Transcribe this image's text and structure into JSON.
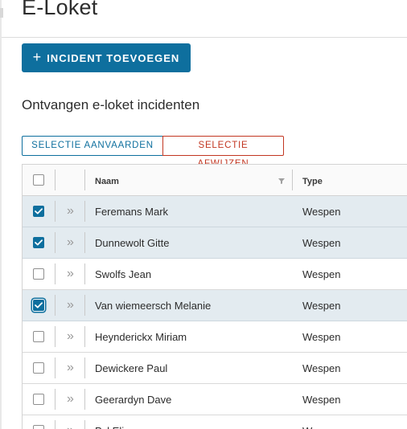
{
  "header": {
    "title": "E-Loket"
  },
  "toolbar": {
    "add_label": "INCIDENT TOEVOEGEN",
    "add_icon": "plus-icon"
  },
  "section": {
    "title": "Ontvangen e-loket incidenten"
  },
  "bulk_actions": {
    "accept_label": "SELECTIE AANVAARDEN",
    "reject_label": "SELECTIE AFWIJZEN"
  },
  "colors": {
    "primary": "#0e6f9e",
    "danger": "#c23621",
    "selected_row": "#e3ebf0"
  },
  "table": {
    "columns": {
      "name": "Naam",
      "type": "Type"
    },
    "rows": [
      {
        "name": "Feremans Mark",
        "type": "Wespen",
        "checked": true,
        "focused": false
      },
      {
        "name": "Dunnewolt Gitte",
        "type": "Wespen",
        "checked": true,
        "focused": false
      },
      {
        "name": "Swolfs Jean",
        "type": "Wespen",
        "checked": false,
        "focused": false
      },
      {
        "name": "Van wiemeersch Melanie",
        "type": "Wespen",
        "checked": true,
        "focused": true
      },
      {
        "name": "Heynderickx Miriam",
        "type": "Wespen",
        "checked": false,
        "focused": false
      },
      {
        "name": "Dewickere Paul",
        "type": "Wespen",
        "checked": false,
        "focused": false
      },
      {
        "name": "Geerardyn Dave",
        "type": "Wespen",
        "checked": false,
        "focused": false
      },
      {
        "name": "Pyl Eline",
        "type": "Wespen",
        "checked": false,
        "focused": false
      }
    ]
  }
}
